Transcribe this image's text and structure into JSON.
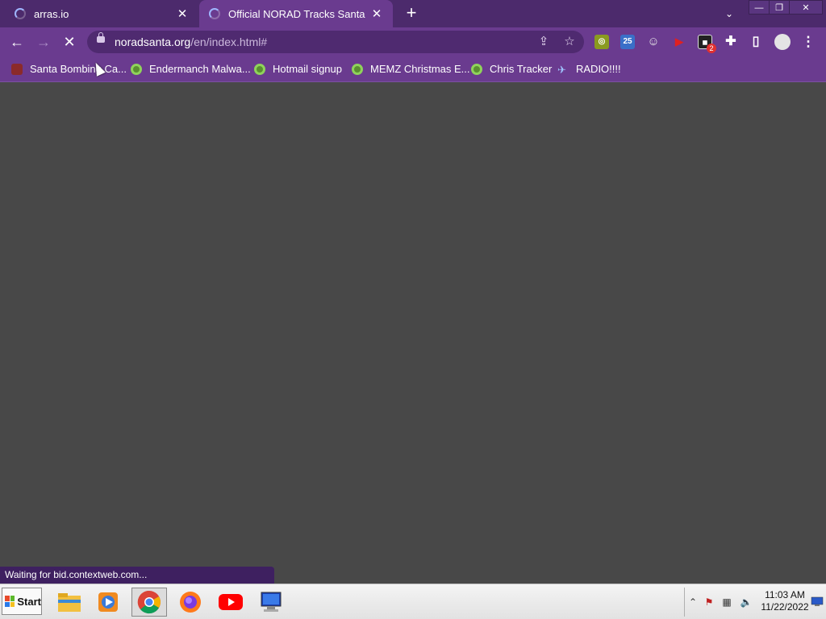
{
  "tabs": [
    {
      "title": "arras.io",
      "active": false,
      "loading": true
    },
    {
      "title": "Official NORAD Tracks Santa",
      "active": true,
      "loading": true
    }
  ],
  "tab_close_glyph": "✕",
  "new_tab_glyph": "+",
  "tab_search_glyph": "⌄",
  "window_controls": {
    "minimize": "—",
    "restore": "❐",
    "close": "✕"
  },
  "nav": {
    "back": "←",
    "forward": "→",
    "reload": "✕"
  },
  "address": {
    "host": "noradsanta.org",
    "path": "/en/index.html#"
  },
  "omnibox_icons": {
    "share": "⇪",
    "star": "☆"
  },
  "extensions": [
    {
      "name": "extension-green-icon",
      "glyph": "◎",
      "color": "#8a9a20"
    },
    {
      "name": "extension-calendar-icon",
      "glyph": "25",
      "color": "#3a6fc8"
    },
    {
      "name": "extension-ghost-icon",
      "glyph": "☺",
      "color": "#e8e8e8"
    },
    {
      "name": "extension-youtube-icon",
      "glyph": "▶",
      "color": "#e02020"
    },
    {
      "name": "extension-dark-icon",
      "glyph": "◼",
      "color": "#222222"
    }
  ],
  "extension_badge": "2",
  "toolbar_icons": {
    "puzzle": "✚",
    "sidepanel": "▯",
    "menu": "⋮"
  },
  "bookmarks": [
    {
      "label": "Santa Bombing Ca...",
      "icon": "santa"
    },
    {
      "label": "Endermanch Malwa...",
      "icon": "green"
    },
    {
      "label": "Hotmail signup",
      "icon": "green"
    },
    {
      "label": "MEMZ Christmas E...",
      "icon": "green"
    },
    {
      "label": "Chris Tracker",
      "icon": "green"
    },
    {
      "label": "RADIO!!!!",
      "icon": "radio"
    }
  ],
  "status_text": "Waiting for bid.contextweb.com...",
  "taskbar": {
    "start_label": "Start",
    "apps": [
      {
        "name": "file-explorer-icon",
        "active": false
      },
      {
        "name": "media-player-icon",
        "active": false
      },
      {
        "name": "chrome-icon",
        "active": true
      },
      {
        "name": "firefox-icon",
        "active": false
      },
      {
        "name": "youtube-icon",
        "active": false
      },
      {
        "name": "computer-icon",
        "active": false
      }
    ],
    "clock_time": "11:03 AM",
    "clock_date": "11/22/2022",
    "tray_icons": {
      "arrow": "⌃",
      "network": "⚑",
      "monitor": "▦",
      "volume": "🔈"
    }
  },
  "colors": {
    "titlebar": "#4c2a6c",
    "toolbar": "#6a3b8f",
    "page_bg": "#484848"
  }
}
